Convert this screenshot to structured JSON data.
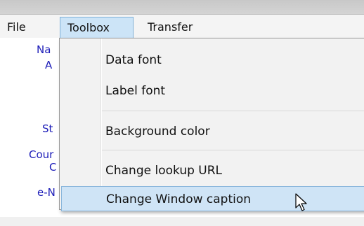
{
  "menubar": {
    "file": "File",
    "toolbox": "Toolbox",
    "transfer": "Transfer"
  },
  "background_labels": [
    "Na",
    "A",
    "St",
    "Cour",
    "C",
    "e-N"
  ],
  "dropdown": {
    "items": [
      {
        "label": "Data font"
      },
      {
        "label": "Label font"
      },
      {
        "label": "Background color"
      },
      {
        "label": "Change lookup URL"
      },
      {
        "label": "Change Window caption"
      }
    ],
    "hovered_index": 4
  },
  "colors": {
    "menu_highlight": "#cce4f7",
    "hover_bg": "#cfe4f6",
    "hover_border": "#8ab6dc",
    "bg_label": "#1c1cb8"
  },
  "icons": {
    "cursor": "arrow-pointer-icon"
  }
}
